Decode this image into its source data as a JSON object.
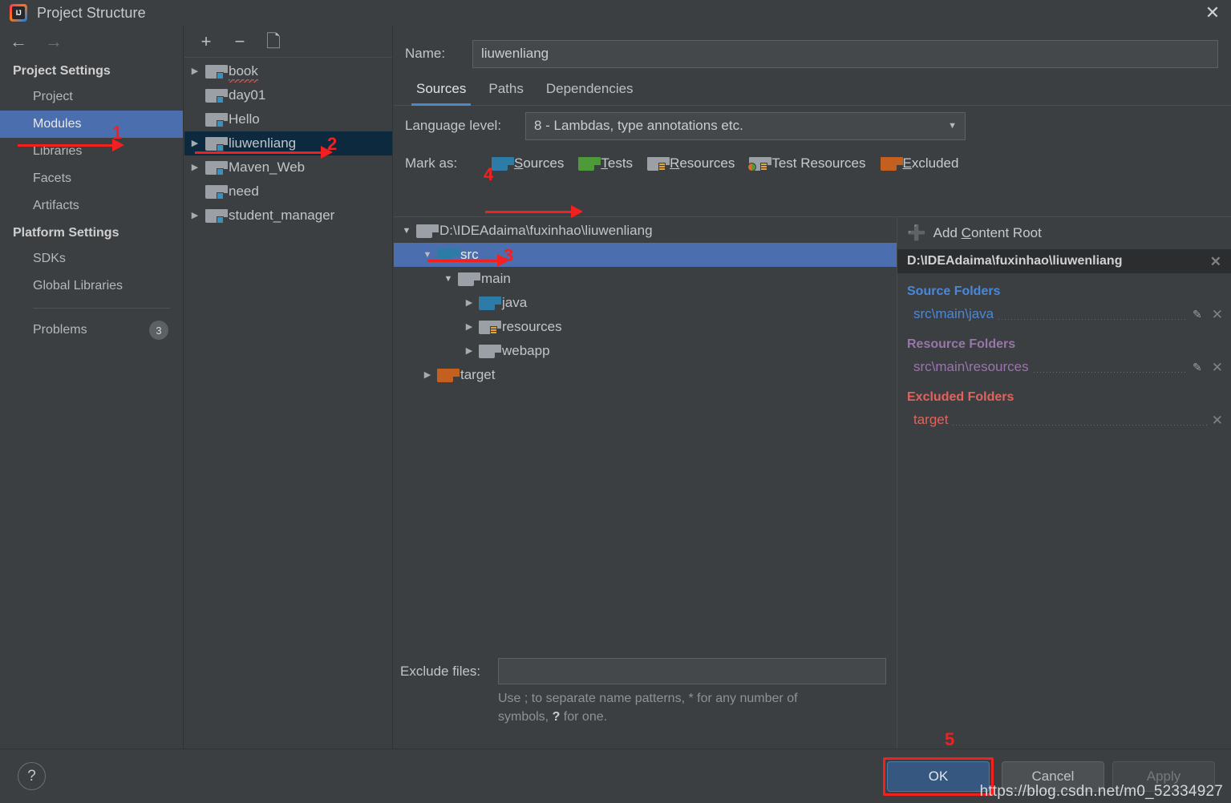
{
  "window": {
    "title": "Project Structure",
    "logo_icon": "intellij-idea-logo",
    "close_icon": "close-icon"
  },
  "sidebar": {
    "back_icon": "arrow-left-icon",
    "forward_icon": "arrow-right-icon",
    "groups": [
      {
        "title": "Project Settings",
        "items": [
          {
            "label": "Project",
            "selected": false
          },
          {
            "label": "Modules",
            "selected": true
          },
          {
            "label": "Libraries",
            "selected": false
          },
          {
            "label": "Facets",
            "selected": false
          },
          {
            "label": "Artifacts",
            "selected": false
          }
        ]
      },
      {
        "title": "Platform Settings",
        "items": [
          {
            "label": "SDKs",
            "selected": false
          },
          {
            "label": "Global Libraries",
            "selected": false
          }
        ]
      }
    ],
    "problems": {
      "label": "Problems",
      "count": "3"
    }
  },
  "modules_panel": {
    "toolbar": {
      "add_icon": "plus-icon",
      "remove_icon": "minus-icon",
      "copy_icon": "copy-icon"
    },
    "items": [
      {
        "label": "book",
        "expandable": true,
        "selected": false,
        "misspelled": true
      },
      {
        "label": "day01",
        "expandable": false,
        "selected": false,
        "misspelled": false
      },
      {
        "label": "Hello",
        "expandable": false,
        "selected": false,
        "misspelled": false
      },
      {
        "label": "liuwenliang",
        "expandable": true,
        "selected": true,
        "misspelled": false
      },
      {
        "label": "Maven_Web",
        "expandable": true,
        "selected": false,
        "misspelled": false
      },
      {
        "label": "need",
        "expandable": false,
        "selected": false,
        "misspelled": false
      },
      {
        "label": "student_manager",
        "expandable": true,
        "selected": false,
        "misspelled": false
      }
    ]
  },
  "main": {
    "name_label": "Name:",
    "name_value": "liuwenliang",
    "tabs": [
      {
        "label": "Sources",
        "active": true
      },
      {
        "label": "Paths",
        "active": false
      },
      {
        "label": "Dependencies",
        "active": false
      }
    ],
    "language_level_label": "Language level:",
    "language_level_value": "8 - Lambdas, type annotations etc.",
    "language_level_caret_icon": "chevron-down-icon",
    "mark_as_label": "Mark as:",
    "mark_as_options": [
      {
        "label": "Sources",
        "mnemonic": "S",
        "icon": "folder-blue-icon",
        "color": "#2d7ca8"
      },
      {
        "label": "Tests",
        "mnemonic": "T",
        "icon": "folder-green-icon",
        "color": "#4d9b38"
      },
      {
        "label": "Resources",
        "mnemonic": "R",
        "icon": "folder-resources-icon",
        "color": "#9aa0a6"
      },
      {
        "label": "Test Resources",
        "mnemonic": "",
        "icon": "folder-test-resources-icon",
        "color": "#9aa0a6"
      },
      {
        "label": "Excluded",
        "mnemonic": "E",
        "icon": "folder-orange-icon",
        "color": "#c4601f"
      }
    ],
    "tree": [
      {
        "label": "D:\\IDEAdaima\\fuxinhao\\liuwenliang",
        "depth": 0,
        "state": "expanded",
        "folder": "gray",
        "selected": false
      },
      {
        "label": "src",
        "depth": 1,
        "state": "expanded",
        "folder": "gray",
        "selected": true
      },
      {
        "label": "main",
        "depth": 2,
        "state": "expanded",
        "folder": "gray",
        "selected": false
      },
      {
        "label": "java",
        "depth": 3,
        "state": "collapsed",
        "folder": "blue",
        "selected": false
      },
      {
        "label": "resources",
        "depth": 3,
        "state": "collapsed",
        "folder": "resources",
        "selected": false
      },
      {
        "label": "webapp",
        "depth": 3,
        "state": "collapsed",
        "folder": "gray",
        "selected": false
      },
      {
        "label": "target",
        "depth": 1,
        "state": "collapsed",
        "folder": "orange",
        "selected": false
      }
    ],
    "exclude_files_label": "Exclude files:",
    "exclude_files_value": "",
    "exclude_files_hint_1": "Use ; to separate name patterns, * for any number of",
    "exclude_files_hint_2a": "symbols, ",
    "exclude_files_hint_2b": "?",
    "exclude_files_hint_2c": " for one."
  },
  "content_roots": {
    "add_label": "Add Content Root",
    "add_icon": "plus-icon",
    "root_path": "D:\\IDEAdaima\\fuxinhao\\liuwenliang",
    "root_remove_icon": "close-icon",
    "sections": [
      {
        "title": "Source Folders",
        "kind": "src",
        "color": "#4a88d8",
        "items": [
          {
            "path": "src\\main\\java",
            "edit_icon": "pencil-icon",
            "remove_icon": "close-icon"
          }
        ]
      },
      {
        "title": "Resource Folders",
        "kind": "res",
        "color": "#9876aa",
        "items": [
          {
            "path": "src\\main\\resources",
            "edit_icon": "pencil-icon",
            "remove_icon": "close-icon"
          }
        ]
      },
      {
        "title": "Excluded Folders",
        "kind": "exc",
        "color": "#e2635d",
        "items": [
          {
            "path": "target",
            "edit_icon": "",
            "remove_icon": "close-icon"
          }
        ]
      }
    ]
  },
  "footer": {
    "help_label": "?",
    "ok_label": "OK",
    "cancel_label": "Cancel",
    "apply_label": "Apply"
  },
  "annotations": {
    "numbers": [
      "1",
      "2",
      "3",
      "4",
      "5"
    ],
    "color": "#f32020",
    "n1": "1",
    "n2": "2",
    "n3": "3",
    "n4": "4",
    "n5": "5"
  },
  "watermark": "https://blog.csdn.net/m0_52334927"
}
